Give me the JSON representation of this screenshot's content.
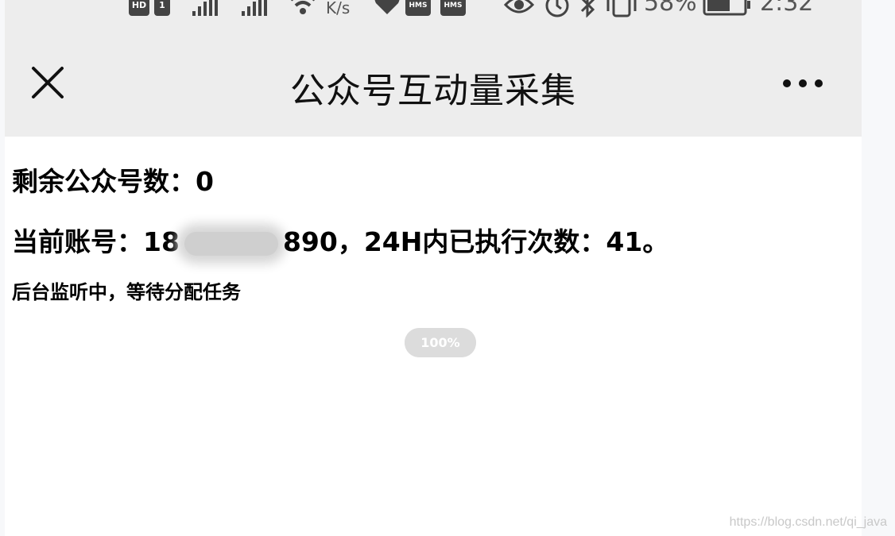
{
  "status_bar": {
    "speed_unit": "K/s",
    "battery": "58%",
    "time": "2:32",
    "icons": [
      "hd-icon",
      "signal-icon",
      "signal-icon",
      "wifi-icon",
      "heart-icon",
      "hms-icon",
      "hms-icon",
      "eye-icon",
      "alarm-icon",
      "bluetooth-icon",
      "vibrate-icon",
      "battery-icon"
    ]
  },
  "header": {
    "title": "公众号互动量采集",
    "close_icon": "close-icon",
    "more_icon": "more-icon"
  },
  "content": {
    "remaining_label": "剩余公众号数：",
    "remaining_value": "0",
    "account_label": "当前账号：",
    "account_prefix": "18",
    "account_suffix": "890",
    "executed_label": "，24H内已执行次数：",
    "executed_value": "41",
    "executed_end": "。",
    "status_message": "后台监听中，等待分配任务"
  },
  "progress": {
    "percent": 100,
    "label": "100%"
  },
  "watermark": "https://blog.csdn.net/qi_java",
  "colors": {
    "header_bg": "#ededed",
    "page_bg": "#ffffff",
    "progress_bg": "#dcdcdc"
  }
}
